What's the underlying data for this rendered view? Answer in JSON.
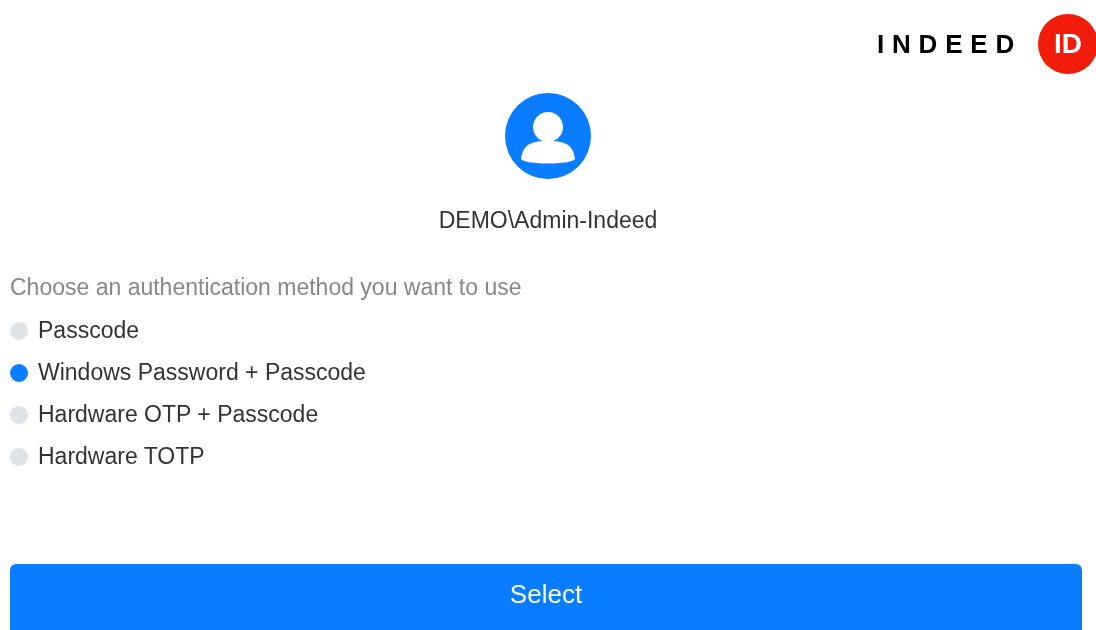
{
  "logo": {
    "wordmark": "INDEED",
    "badge": "ID"
  },
  "user": {
    "name": "DEMO\\Admin-Indeed"
  },
  "prompt": "Choose an authentication method you want to use",
  "methods": [
    {
      "label": "Passcode",
      "selected": false
    },
    {
      "label": "Windows Password + Passcode",
      "selected": true
    },
    {
      "label": "Hardware OTP + Passcode",
      "selected": false
    },
    {
      "label": "Hardware TOTP",
      "selected": false
    }
  ],
  "buttons": [
    {
      "label": "Select"
    }
  ]
}
